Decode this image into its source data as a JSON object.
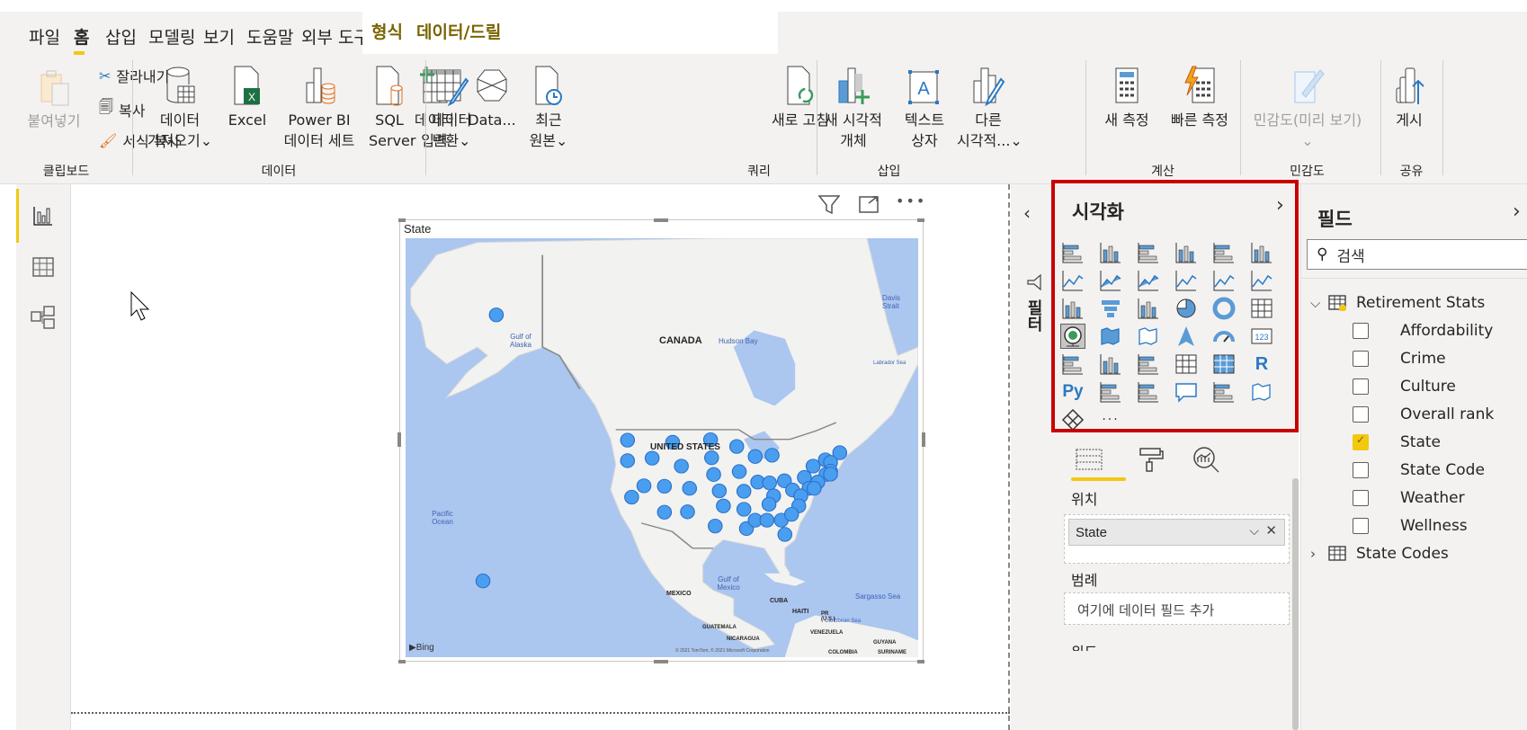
{
  "tabs": [
    {
      "label": "파일"
    },
    {
      "label": "홈",
      "active": true
    },
    {
      "label": "삽입"
    },
    {
      "label": "모델링"
    },
    {
      "label": "보기"
    },
    {
      "label": "도움말"
    },
    {
      "label": "외부 도구"
    },
    {
      "label": "형식",
      "contextual": true
    },
    {
      "label": "데이터/드릴",
      "contextual": true
    }
  ],
  "ribbon": {
    "clipboard": {
      "paste": "붙여넣기",
      "cut": "잘라내기",
      "copy": "복사",
      "format_painter": "서식 복사",
      "group": "클립보드"
    },
    "data": {
      "get_data_1": "데이터",
      "get_data_2": "가져오기",
      "excel": "Excel",
      "pbi_1": "Power BI",
      "pbi_2": "데이터 세트",
      "sql_1": "SQL",
      "sql_2": "Server",
      "enter_1": "데이터",
      "enter_2": "입력",
      "dataverse": "Data...",
      "recent_1": "최근",
      "recent_2": "원본",
      "group": "데이터"
    },
    "query": {
      "transform_1": "데이터",
      "transform_2": "변환",
      "refresh": "새로 고침",
      "group": "쿼리"
    },
    "insert": {
      "new_visual_1": "새 시각적",
      "new_visual_2": "개체",
      "textbox_1": "텍스트",
      "textbox_2": "상자",
      "more_1": "다른",
      "more_2": "시각적...",
      "group": "삽입"
    },
    "calc": {
      "new_measure": "새 측정",
      "quick_measure": "빠른 측정",
      "group": "계산"
    },
    "sensitivity": {
      "label": "민감도(미리 보기)",
      "group": "민감도"
    },
    "share": {
      "publish": "게시",
      "group": "공유"
    }
  },
  "visual": {
    "title": "State",
    "map_labels": {
      "canada": "CANADA",
      "us": "UNITED STATES",
      "mexico": "MEXICO",
      "cuba": "CUBA",
      "haiti": "HAITI",
      "pr": "PR (U.S.)",
      "guatemala": "GUATEMALA",
      "nicaragua": "NICARAGUA",
      "venezuela": "VENEZUELA",
      "guyana": "GUYANA",
      "colombia": "COLOMBIA",
      "suriname": "SURINAME",
      "gulf_alaska": "Gulf of Alaska",
      "hudson": "Hudson Bay",
      "davis": "Davis Strait",
      "labrador": "Labrador Sea",
      "pacific": "Pacific Ocean",
      "gulf_mexico": "Gulf of Mexico",
      "sargasso": "Sargasso Sea",
      "caribbean": "Caribbean Sea"
    },
    "attribution": "© 2021 TomTom, © 2021 Microsoft Corporation",
    "bing": "Bing",
    "bubble_color": "#4a9ef0"
  },
  "filters": {
    "label": "필터"
  },
  "viz": {
    "title": "시각화",
    "icons": [
      "stacked-bar",
      "stacked-column",
      "clustered-bar",
      "clustered-column",
      "100-stacked-bar",
      "100-stacked-column",
      "line",
      "area",
      "stacked-area",
      "line-clustered-column",
      "line-stacked-column",
      "ribbon",
      "waterfall",
      "funnel",
      "scatter",
      "pie",
      "donut",
      "treemap",
      "map",
      "filled-map",
      "shape-map",
      "azure-map",
      "gauge",
      "card",
      "multi-row-card",
      "kpi",
      "slicer",
      "table",
      "matrix",
      "r-visual",
      "python-visual",
      "key-influencers",
      "decomposition-tree",
      "qa",
      "smart-narrative",
      "arcgis-map",
      "power-apps",
      "more"
    ],
    "selected": "map",
    "tabs": [
      "fields-tab",
      "format-tab",
      "analytics-tab"
    ],
    "wells": {
      "location": "위치",
      "location_value": "State",
      "legend": "범례",
      "legend_placeholder": "여기에 데이터 필드 추가",
      "latitude": "위도"
    }
  },
  "fields": {
    "title": "필드",
    "search_placeholder": "검색",
    "tables": [
      {
        "name": "Retirement Stats",
        "expanded": true,
        "items": [
          {
            "name": "Affordability",
            "checked": false
          },
          {
            "name": "Crime",
            "checked": false
          },
          {
            "name": "Culture",
            "checked": false
          },
          {
            "name": "Overall rank",
            "checked": false
          },
          {
            "name": "State",
            "checked": true
          },
          {
            "name": "State Code",
            "checked": false
          },
          {
            "name": "Weather",
            "checked": false
          },
          {
            "name": "Wellness",
            "checked": false
          }
        ]
      },
      {
        "name": "State Codes",
        "expanded": false
      }
    ]
  },
  "colors": {
    "accent": "#f2c811",
    "highlight_box": "#c80000",
    "ocean": "#abc6ef",
    "land": "#f2f2f0"
  }
}
